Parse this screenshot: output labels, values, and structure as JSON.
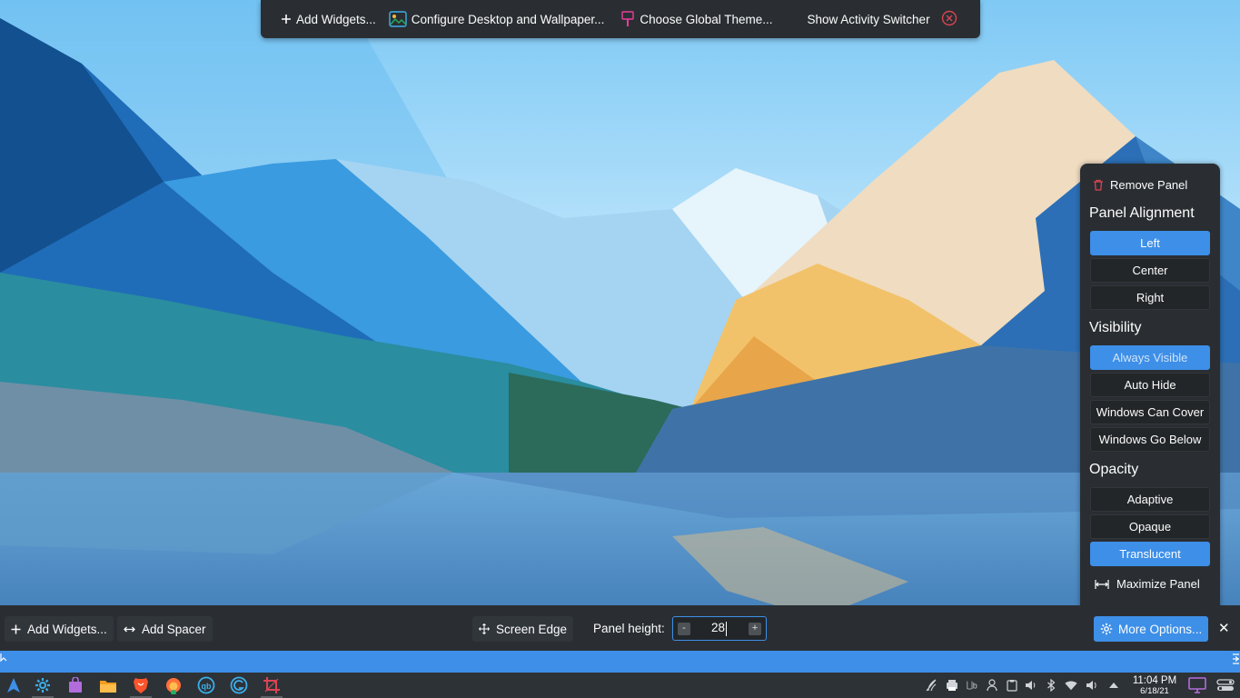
{
  "colors": {
    "accent": "#3d8fe8",
    "panel_bg": "#2a2e32",
    "taskbar_bg": "#2d3237",
    "danger": "#da4453"
  },
  "top_toolbar": {
    "add_widgets": "Add Widgets...",
    "configure_desktop": "Configure Desktop and Wallpaper...",
    "choose_theme": "Choose Global Theme...",
    "activity_switcher": "Show Activity Switcher"
  },
  "more_options_popup": {
    "remove_panel": "Remove Panel",
    "alignment_heading": "Panel Alignment",
    "alignment": [
      "Left",
      "Center",
      "Right"
    ],
    "alignment_selected": "Left",
    "visibility_heading": "Visibility",
    "visibility": [
      "Always Visible",
      "Auto Hide",
      "Windows Can Cover",
      "Windows Go Below"
    ],
    "visibility_selected": "Always Visible",
    "opacity_heading": "Opacity",
    "opacity": [
      "Adaptive",
      "Opaque",
      "Translucent"
    ],
    "opacity_selected": "Translucent",
    "maximize_panel": "Maximize Panel"
  },
  "panel_config": {
    "add_widgets": "Add Widgets...",
    "add_spacer": "Add Spacer",
    "screen_edge": "Screen Edge",
    "panel_height_label": "Panel height:",
    "panel_height_value": "28",
    "minus_label": "-",
    "plus_label": "+",
    "more_options": "More Options...",
    "close_label": "✕"
  },
  "taskbar": {
    "apps": [
      "application-launcher-icon",
      "system-settings-icon",
      "discover-store-icon",
      "file-manager-icon",
      "brave-browser-icon",
      "firefox-icon",
      "qbittorrent-icon",
      "browser-g-icon",
      "screenshot-crop-icon"
    ],
    "tray": [
      "plasma-vault-icon",
      "printer-icon",
      "bitwarden-icon",
      "user-switcher-icon",
      "clipboard-icon",
      "volume-icon",
      "bluetooth-icon",
      "wifi-icon",
      "media-volume-icon",
      "expand-tray-arrow-icon"
    ],
    "time": "11:04 PM",
    "date": "6/18/21"
  }
}
